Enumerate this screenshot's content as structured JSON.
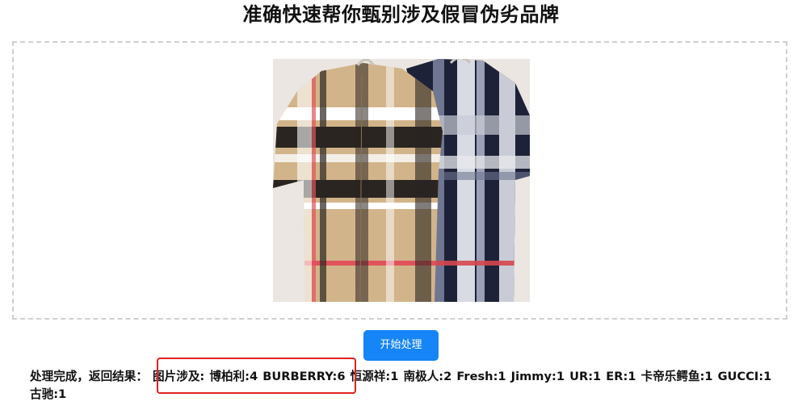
{
  "header": {
    "title": "准确快速帮你甄别涉及假冒伪劣品牌"
  },
  "upload": {
    "image_alt": "两件格纹短袖衬衫"
  },
  "actions": {
    "start_button": "开始处理"
  },
  "result": {
    "prefix": "处理完成，返回结果：",
    "lead": "图片涉及:",
    "items": [
      "博柏利:4",
      "BURBERRY:6",
      "恒源祥:1",
      "南极人:2",
      "Fresh:1",
      "Jimmy:1",
      "UR:1",
      "ER:1",
      "卡帝乐鳄鱼:1",
      "GUCCI:1",
      "古驰:1"
    ]
  },
  "colors": {
    "button": "#1685f7",
    "highlight": "#e22121",
    "dashed_border": "#cfcfcf"
  }
}
